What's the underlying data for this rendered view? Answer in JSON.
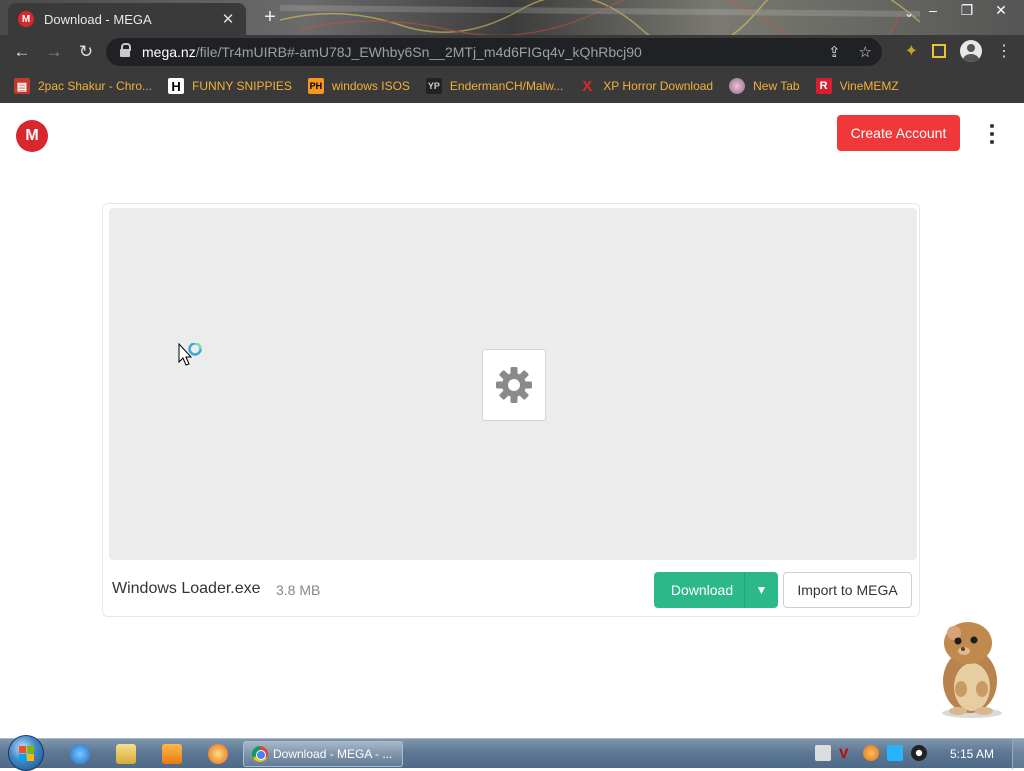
{
  "browser": {
    "tab_title": "Download - MEGA",
    "tab_favicon": "mega-logo-icon",
    "url_host": "mega.nz",
    "url_path": "/file/Tr4mUIRB#-amU78J_EWhby6Sn__2MTj_m4d6FIGq4v_kQhRbcj90",
    "bookmarks": [
      {
        "label": "2pac Shakur - Chro...",
        "icon": "bookmark-favicon"
      },
      {
        "label": "FUNNY SNIPPIES",
        "icon": "h-icon"
      },
      {
        "label": "windows ISOS",
        "icon": "ph-icon"
      },
      {
        "label": "EndermanCH/Malw...",
        "icon": "yp-icon"
      },
      {
        "label": "XP Horror Download",
        "icon": "x-icon"
      },
      {
        "label": "New Tab",
        "icon": "globe-icon"
      },
      {
        "label": "VineMEMZ",
        "icon": "r-icon"
      }
    ]
  },
  "page": {
    "logo_letter": "M",
    "create_account_label": "Create Account",
    "file_name": "Windows Loader.exe",
    "file_size": "3.8 MB",
    "download_label": "Download",
    "import_label": "Import to MEGA",
    "file_icon": "gear-icon"
  },
  "taskbar": {
    "task_label": "Download - MEGA - ...",
    "clock": "5:15 AM"
  },
  "colors": {
    "mega_red": "#d9272e",
    "create_button": "#f0373a",
    "download_green": "#2db889",
    "bookmark_text": "#f3b13c"
  }
}
